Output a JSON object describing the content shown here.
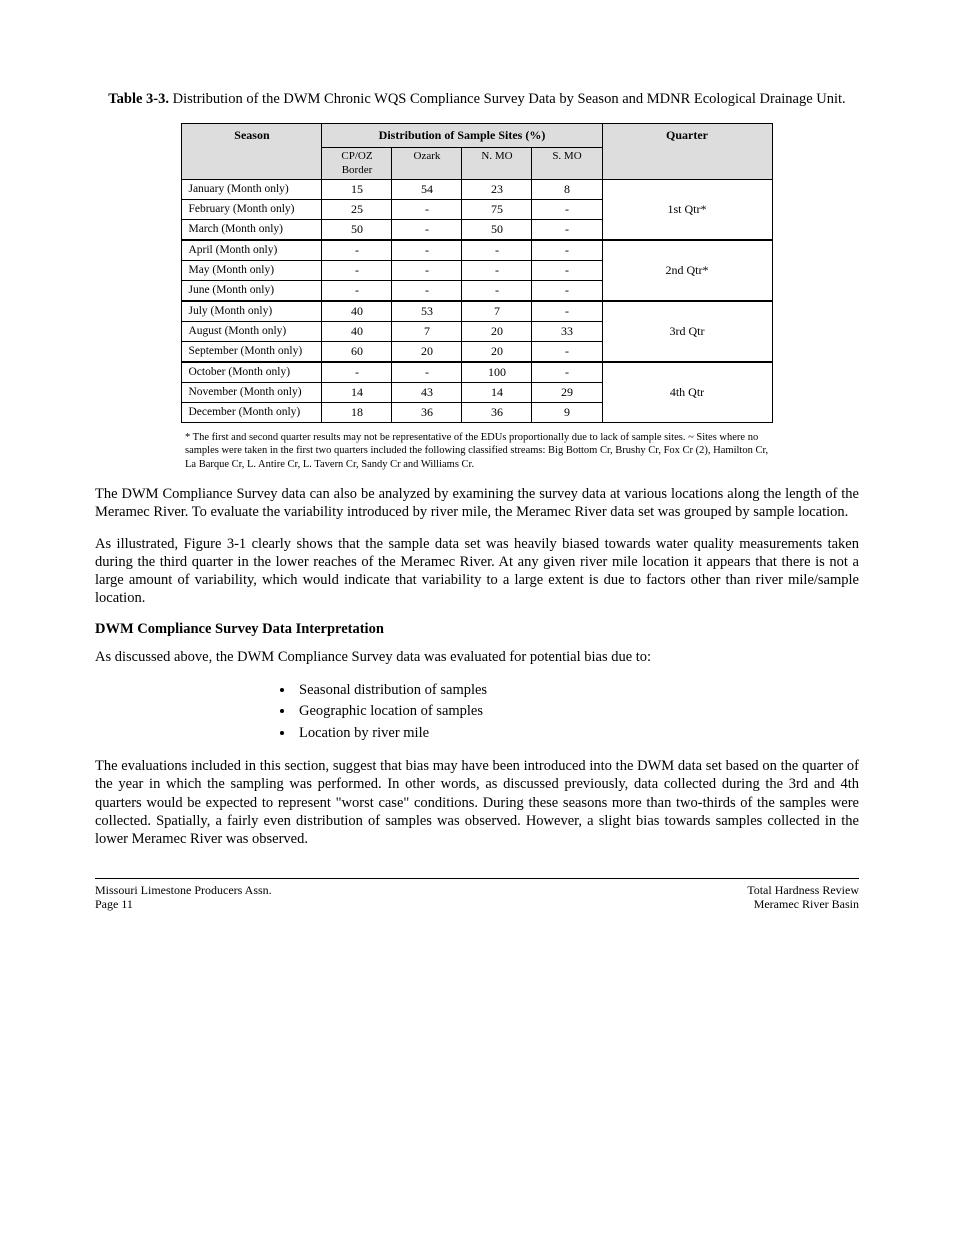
{
  "tableTitle": {
    "prefix": "Table 3-3.",
    "text": "Distribution of the DWM Chronic WQS Compliance Survey Data by Season and MDNR Ecological Drainage Unit."
  },
  "table": {
    "headers": {
      "main": [
        "Season",
        "Distribution of Sample Sites (%)",
        "Quarter"
      ],
      "sub": [
        "CP/OZ Border",
        "Ozark",
        "N. MO",
        "S. MO"
      ]
    },
    "groups": [
      {
        "rows": [
          {
            "label": "January (Month only)",
            "cells": [
              "15",
              "54",
              "23",
              "8"
            ]
          },
          {
            "label": "February (Month only)",
            "cells": [
              "25",
              "-",
              "75",
              "-"
            ]
          },
          {
            "label": "March (Month only)",
            "cells": [
              "50",
              "-",
              "50",
              "-"
            ]
          }
        ],
        "quarter": "1st Qtr*"
      },
      {
        "rows": [
          {
            "label": "April (Month only)",
            "cells": [
              "-",
              "-",
              "-",
              "-"
            ]
          },
          {
            "label": "May (Month only)",
            "cells": [
              "-",
              "-",
              "-",
              "-"
            ]
          },
          {
            "label": "June (Month only)",
            "cells": [
              "-",
              "-",
              "-",
              "-"
            ]
          }
        ],
        "quarter": "2nd Qtr*"
      },
      {
        "rows": [
          {
            "label": "July (Month only)",
            "cells": [
              "40",
              "53",
              "7",
              "-"
            ]
          },
          {
            "label": "August (Month only)",
            "cells": [
              "40",
              "7",
              "20",
              "33"
            ]
          },
          {
            "label": "September (Month only)",
            "cells": [
              "60",
              "20",
              "20",
              "-"
            ]
          }
        ],
        "quarter": "3rd Qtr"
      },
      {
        "rows": [
          {
            "label": "October (Month only)",
            "cells": [
              "-",
              "-",
              "100",
              "-"
            ]
          },
          {
            "label": "November (Month only)",
            "cells": [
              "14",
              "43",
              "14",
              "29"
            ]
          },
          {
            "label": "December (Month only)",
            "cells": [
              "18",
              "36",
              "36",
              "9"
            ]
          }
        ],
        "quarter": "4th Qtr"
      }
    ],
    "footnote": "* The first and second quarter results may not be representative of the EDUs proportionally due to lack of sample sites. ~ Sites where no samples were taken in the first two quarters included the following classified streams: Big Bottom Cr, Brushy Cr, Fox Cr (2), Hamilton Cr, La Barque Cr, L. Antire Cr, L. Tavern Cr, Sandy Cr and Williams Cr."
  },
  "paragraphs": {
    "p1": "The DWM Compliance Survey data can also be analyzed by examining the survey data at various locations along the length of the Meramec River. To evaluate the variability introduced by river mile, the Meramec River data set was grouped by sample location.",
    "p2": "As illustrated, Figure 3-1 clearly shows that the sample data set was heavily biased towards water quality measurements taken during the third quarter in the lower reaches of the Meramec River. At any given river mile location it appears that there is not a large amount of variability, which would indicate that variability to a large extent is due to factors other than river mile/sample location.",
    "p3": "As discussed above, the DWM Compliance Survey data was evaluated for potential bias due to:"
  },
  "sectionTitle": "DWM Compliance Survey Data Interpretation",
  "bullets": [
    "Seasonal distribution of samples",
    "Geographic location of samples",
    "Location by river mile"
  ],
  "paragraphConclusion": "The evaluations included in this section, suggest that bias may have been introduced into the DWM data set based on the quarter of the year in which the sampling was performed. In other words, as discussed previously, data collected during the 3rd and 4th quarters would be expected to represent \"worst case\" conditions. During these seasons more than two-thirds of the samples were collected. Spatially, a fairly even distribution of samples was observed. However, a slight bias towards samples collected in the lower Meramec River was observed.",
  "footer": {
    "leftTop": "Missouri Limestone Producers Assn.",
    "leftBottom": "Page 11",
    "rightTop": "Total Hardness Review",
    "rightBottom": "Meramec River Basin"
  }
}
